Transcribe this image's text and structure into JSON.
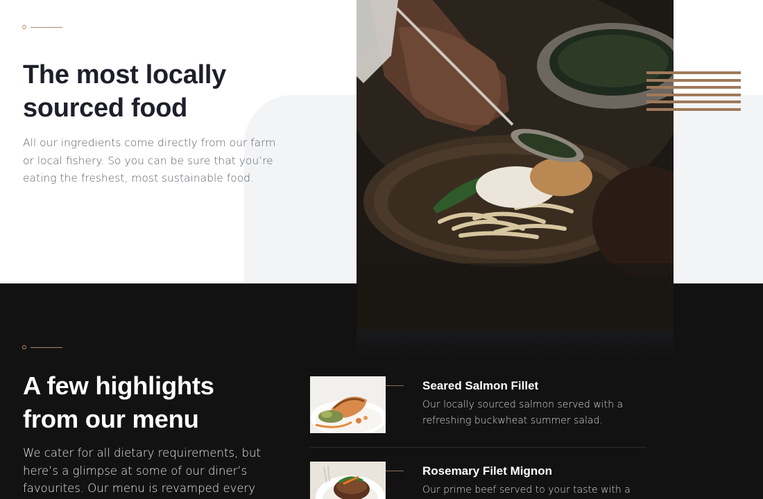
{
  "intro": {
    "title_line1": "The most locally",
    "title_line2": "sourced food",
    "description": "All our ingredients come directly from our farm or local fishery. So you can be sure that you’re eating the freshest, most sustainable food.",
    "image_icon": "chef-plating-dish-photo"
  },
  "highlights": {
    "title_line1": "A few highlights",
    "title_line2": "from our menu",
    "description": "We cater for all dietary requirements, but here’s a glimpse at some of our diner’s favourites. Our menu is revamped every season.",
    "items": [
      {
        "name": "Seared Salmon Fillet",
        "description": "Our locally sourced salmon served with a refreshing buckwheat summer salad.",
        "image_icon": "salmon-dish-photo"
      },
      {
        "name": "Rosemary Filet Mignon",
        "description": "Our prime beef served to your taste with a",
        "image_icon": "filet-mignon-photo"
      }
    ]
  },
  "colors": {
    "accent": "#a07a5a",
    "dark_bg": "#121212",
    "light_grey": "#f3f4f6",
    "heading_dark": "#1d1f2a"
  }
}
